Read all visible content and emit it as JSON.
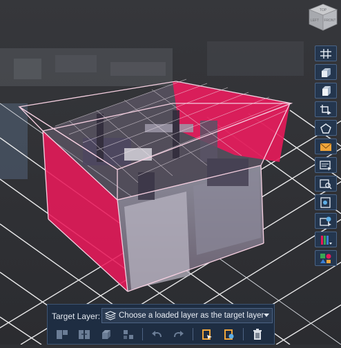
{
  "navcube": {
    "faces": [
      "TOP",
      "LEFT",
      "FRONT"
    ]
  },
  "toolbar_right": {
    "tools": [
      {
        "icon": "grid-icon",
        "name": "grid"
      },
      {
        "icon": "extrude-box-icon",
        "name": "extrude"
      },
      {
        "icon": "box-icon",
        "name": "box"
      },
      {
        "icon": "crop-select-icon",
        "name": "crop-select"
      },
      {
        "icon": "polygon-icon",
        "name": "polygon"
      },
      {
        "icon": "envelope-icon",
        "name": "envelope"
      },
      {
        "icon": "layer-edit-icon",
        "name": "layer-edit"
      },
      {
        "icon": "layer-search-icon",
        "name": "layer-search"
      },
      {
        "icon": "layer-select-icon",
        "name": "layer-select"
      },
      {
        "icon": "layer-color-icon",
        "name": "layer-color"
      },
      {
        "icon": "color-bars-icon",
        "name": "color-bars"
      },
      {
        "icon": "classify-icon",
        "name": "classify"
      }
    ]
  },
  "bottom_panel": {
    "target_label": "Target Layer:",
    "layer_select_value": "Choose a loaded layer as the target layer",
    "actions": [
      {
        "icon": "split-icon",
        "name": "split"
      },
      {
        "icon": "merge-icon",
        "name": "merge"
      },
      {
        "icon": "cube-icon",
        "name": "cube"
      },
      {
        "icon": "subdivide-icon",
        "name": "subdivide"
      },
      {
        "icon": "undo-icon",
        "name": "undo"
      },
      {
        "icon": "redo-icon",
        "name": "redo"
      },
      {
        "icon": "export-layer-icon",
        "name": "export-layer"
      },
      {
        "icon": "layer-settings-icon",
        "name": "layer-settings"
      },
      {
        "icon": "trash-icon",
        "name": "delete"
      }
    ]
  },
  "colors": {
    "background": "#2f3034",
    "accent_magenta": "#e8195a",
    "panel_bg": "#1e2d42",
    "grid_line": "#f2f2f2"
  }
}
